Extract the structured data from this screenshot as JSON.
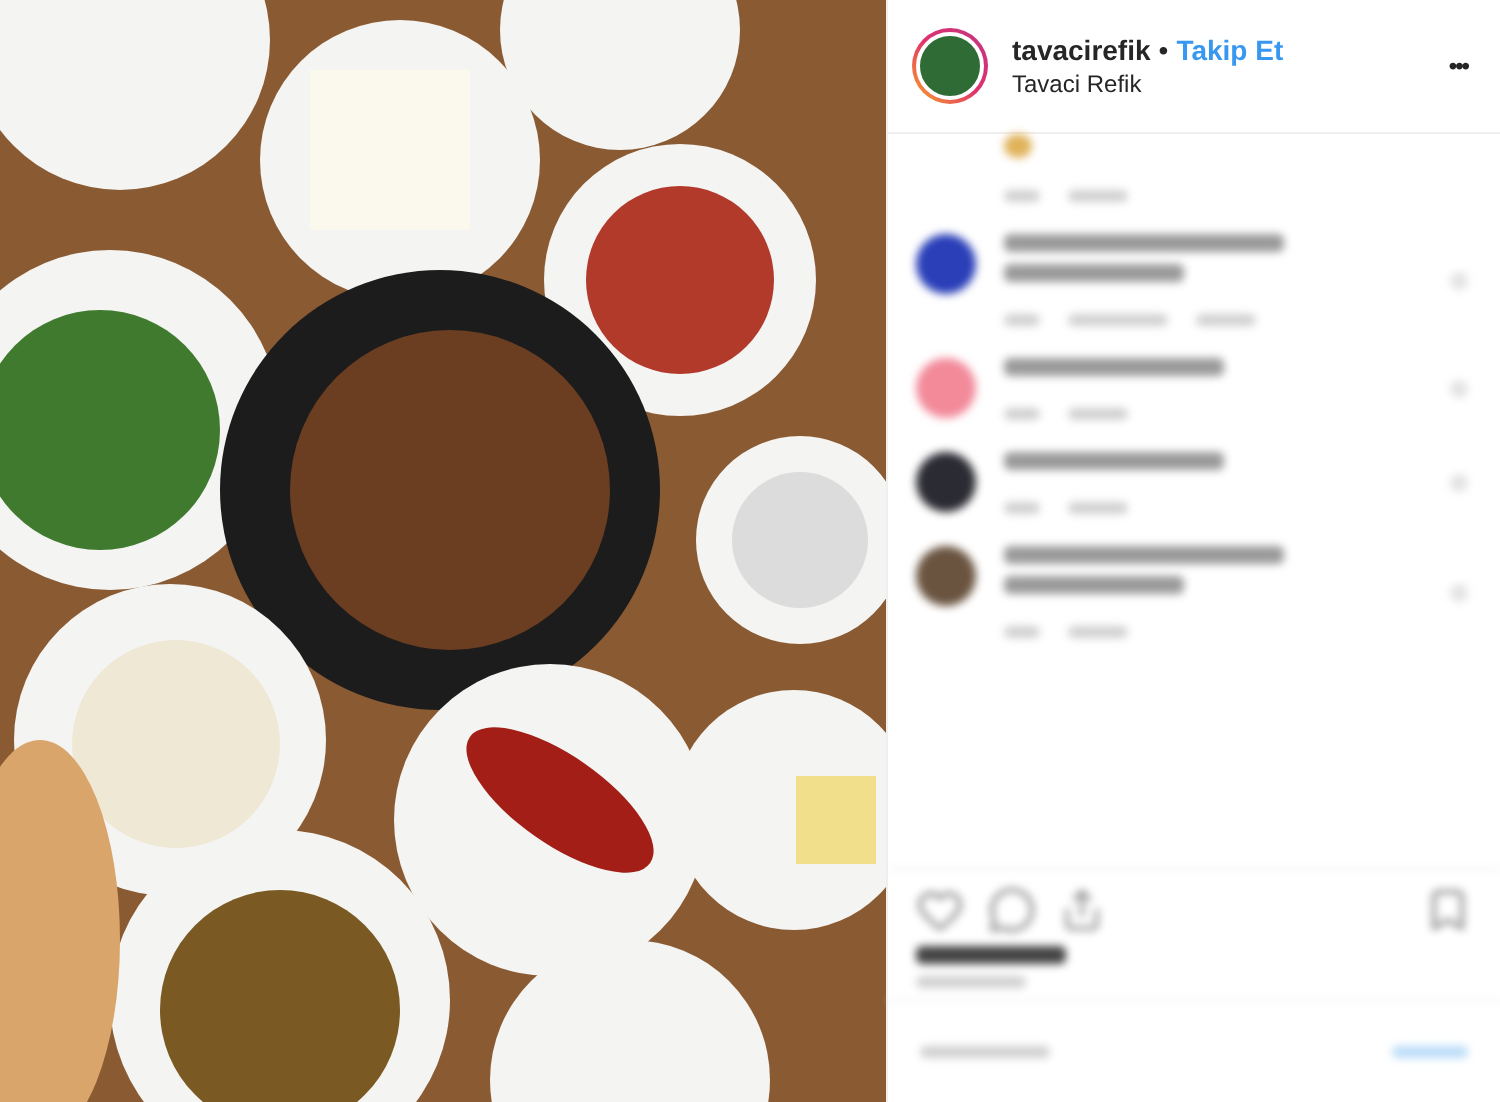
{
  "post": {
    "username": "tavacirefik",
    "separator": "•",
    "follow_button": "Takip Et",
    "location": "Tavaci Refik",
    "more_button": "•••"
  },
  "comments": [
    {
      "kind": "tail"
    },
    {
      "kind": "long-with-replies",
      "color": "#2a3fb8"
    },
    {
      "kind": "short",
      "color": "#f28a9a"
    },
    {
      "kind": "short",
      "color": "#2b2b33"
    },
    {
      "kind": "long",
      "color": "#6a5440"
    }
  ]
}
